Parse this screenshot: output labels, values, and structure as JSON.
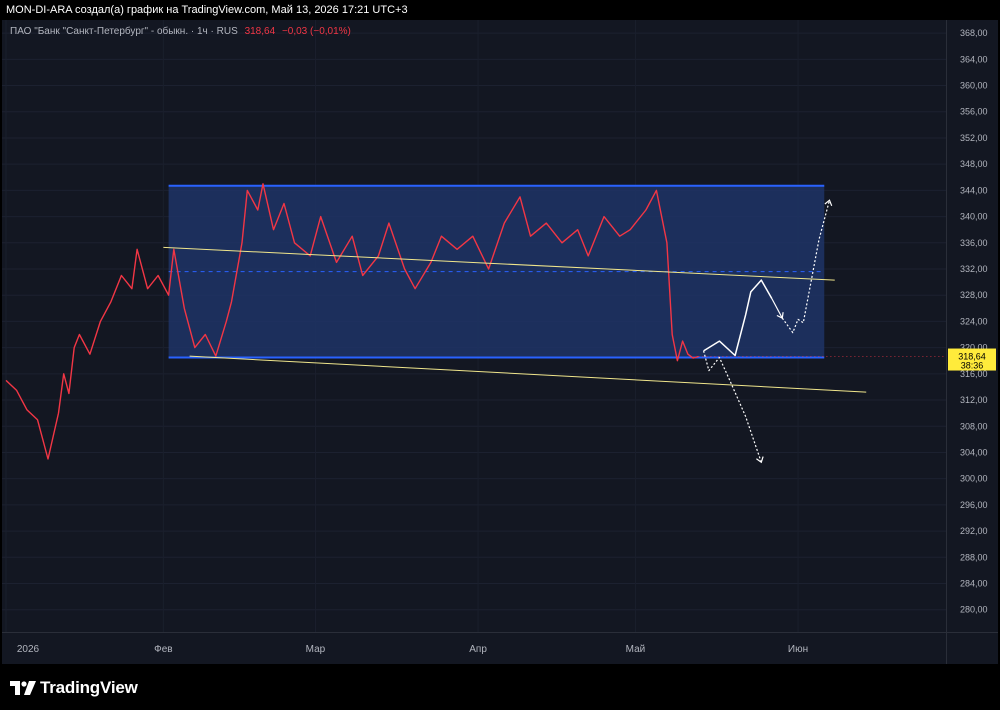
{
  "header": {
    "attribution": "MON-DI-ARA создал(а) график на TradingView.com, Май 13, 2026 17:21 UTC+3"
  },
  "legend": {
    "symbol": "ПАО \"Банк \"Санкт-Петербург\" - обыкн. · 1ч · RUS",
    "price": "318,64",
    "change": "−0,03 (−0,01%)"
  },
  "price_tag": {
    "price": "318,64",
    "countdown": "38:36"
  },
  "footer": {
    "brand": "TradingView"
  },
  "colors": {
    "background": "#131722",
    "candle_line": "#f23645",
    "channel_border": "#2962ff",
    "channel_fill": "#1f3466",
    "trendline": "#f0e68c",
    "projection": "#ffffff",
    "price_tag": "#ffeb3b"
  },
  "chart_data": {
    "type": "line",
    "title": "ПАО \"Банк \"Санкт-Петербург\" - обыкн. · 1ч · RUS",
    "y_axis_ticks": [
      "280,00",
      "284,00",
      "288,00",
      "292,00",
      "296,00",
      "300,00",
      "304,00",
      "308,00",
      "312,00",
      "316,00",
      "320,00",
      "324,00",
      "328,00",
      "332,00",
      "336,00",
      "340,00",
      "344,00",
      "348,00",
      "352,00",
      "356,00",
      "360,00",
      "364,00",
      "368,00"
    ],
    "x_axis_ticks": [
      "2026",
      "Фев",
      "Мар",
      "Апр",
      "Май",
      "Июн"
    ],
    "ylim": [
      276.6,
      370.0
    ],
    "x_range": [
      "2026-01-01",
      "2026-06-09"
    ],
    "series": [
      {
        "x": [
          "2026-01-01",
          "2026-01-03",
          "2026-01-05",
          "2026-01-07",
          "2026-01-09",
          "2026-01-11",
          "2026-01-12",
          "2026-01-13",
          "2026-01-14",
          "2026-01-15",
          "2026-01-17",
          "2026-01-19",
          "2026-01-21",
          "2026-01-23",
          "2026-01-25",
          "2026-01-26",
          "2026-01-28",
          "2026-01-30",
          "2026-02-01",
          "2026-02-02",
          "2026-02-04",
          "2026-02-06",
          "2026-02-08",
          "2026-02-10",
          "2026-02-12",
          "2026-02-13",
          "2026-02-15",
          "2026-02-16",
          "2026-02-18",
          "2026-02-19",
          "2026-02-21",
          "2026-02-23",
          "2026-02-25",
          "2026-02-28",
          "2026-03-02",
          "2026-03-05",
          "2026-03-08",
          "2026-03-10",
          "2026-03-13",
          "2026-03-15",
          "2026-03-18",
          "2026-03-20",
          "2026-03-23",
          "2026-03-25",
          "2026-03-28",
          "2026-03-31",
          "2026-04-03",
          "2026-04-06",
          "2026-04-09",
          "2026-04-11",
          "2026-04-14",
          "2026-04-17",
          "2026-04-20",
          "2026-04-22",
          "2026-04-25",
          "2026-04-28",
          "2026-04-30",
          "2026-05-03",
          "2026-05-05",
          "2026-05-07",
          "2026-05-08",
          "2026-05-09",
          "2026-05-10",
          "2026-05-11",
          "2026-05-12",
          "2026-05-13"
        ],
        "values": [
          315.0,
          313.5,
          310.5,
          309.0,
          303.0,
          310.0,
          316.0,
          313.0,
          320.0,
          322.0,
          319.0,
          324.0,
          327.0,
          331.0,
          329.0,
          335.0,
          329.0,
          331.0,
          328.0,
          335.0,
          326.0,
          320.0,
          322.0,
          318.7,
          324.0,
          327.0,
          336.0,
          344.0,
          341.0,
          345.0,
          338.0,
          342.0,
          336.0,
          334.0,
          340.0,
          333.0,
          337.0,
          331.0,
          334.0,
          339.0,
          332.0,
          329.0,
          333.0,
          337.0,
          335.0,
          337.0,
          332.0,
          339.0,
          343.0,
          337.0,
          339.0,
          336.0,
          338.0,
          334.0,
          340.0,
          337.0,
          338.0,
          341.0,
          344.0,
          336.0,
          322.0,
          318.0,
          321.0,
          319.0,
          318.4,
          318.64
        ]
      }
    ],
    "annotations": {
      "channel": {
        "top": 344.7,
        "bottom": 318.5,
        "from": "2026-02-01",
        "to": "2026-06-06"
      },
      "trendline_upper": {
        "from": [
          "2026-01-31",
          335.3
        ],
        "to": [
          "2026-06-08",
          330.3
        ]
      },
      "trendline_lower": {
        "from": [
          "2026-02-05",
          318.7
        ],
        "to": [
          "2026-06-14",
          313.2
        ]
      },
      "projection_bull": {
        "x": [
          "2026-05-14",
          "2026-05-17",
          "2026-05-20",
          "2026-05-22",
          "2026-05-23",
          "2026-05-25",
          "2026-05-27"
        ],
        "values": [
          319.5,
          321.0,
          318.8,
          325.0,
          328.5,
          330.3,
          327.5
        ]
      },
      "projection_bull_tail": {
        "x": [
          "2026-05-27",
          "2026-05-29"
        ],
        "values": [
          327.5,
          324.5
        ]
      },
      "projection_dotted_up": {
        "x": [
          "2026-05-29",
          "2026-05-31",
          "2026-06-01",
          "2026-06-02",
          "2026-06-03",
          "2026-06-05",
          "2026-06-07"
        ],
        "values": [
          324.5,
          322.3,
          324.3,
          323.8,
          328.0,
          336.5,
          342.5
        ]
      },
      "projection_dotted_down": {
        "x": [
          "2026-05-14",
          "2026-05-15",
          "2026-05-17",
          "2026-05-19",
          "2026-05-22",
          "2026-05-25"
        ],
        "values": [
          319.5,
          316.5,
          318.5,
          315.0,
          309.5,
          302.5
        ]
      }
    }
  }
}
